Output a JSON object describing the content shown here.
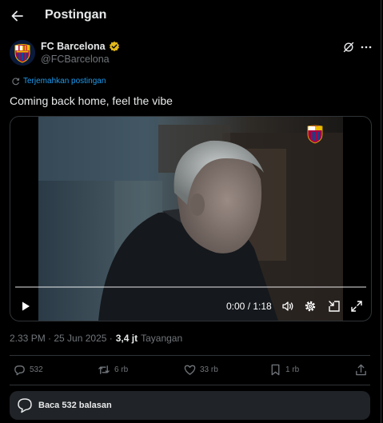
{
  "header": {
    "title": "Postingan"
  },
  "author": {
    "name": "FC Barcelona",
    "handle": "@FCBarcelona"
  },
  "post": {
    "translate_label": "Terjemahkan postingan",
    "text": "Coming back home, feel the vibe",
    "timestamp": "2.33 PM · 25 Jun 2025 ·",
    "views_count": "3,4 jt",
    "views_label": "Tayangan"
  },
  "video": {
    "time": "0:00 / 1:18",
    "progress": 0
  },
  "actions": {
    "replies": "532",
    "reposts": "6 rb",
    "likes": "33 rb",
    "bookmarks": "1 rb"
  },
  "read_replies": {
    "label": "Baca 532 balasan"
  },
  "colors": {
    "accent": "#1d9bf0",
    "verified": "#e2b719",
    "muted": "#71767b",
    "background": "#000000"
  },
  "icons": [
    "back-arrow-icon",
    "verified-badge-icon",
    "grok-icon",
    "more-icon",
    "translate-icon",
    "play-icon",
    "volume-icon",
    "settings-icon",
    "picture-in-picture-icon",
    "fullscreen-icon",
    "reply-icon",
    "repost-icon",
    "like-icon",
    "bookmark-icon",
    "share-icon",
    "chat-bubble-icon"
  ]
}
